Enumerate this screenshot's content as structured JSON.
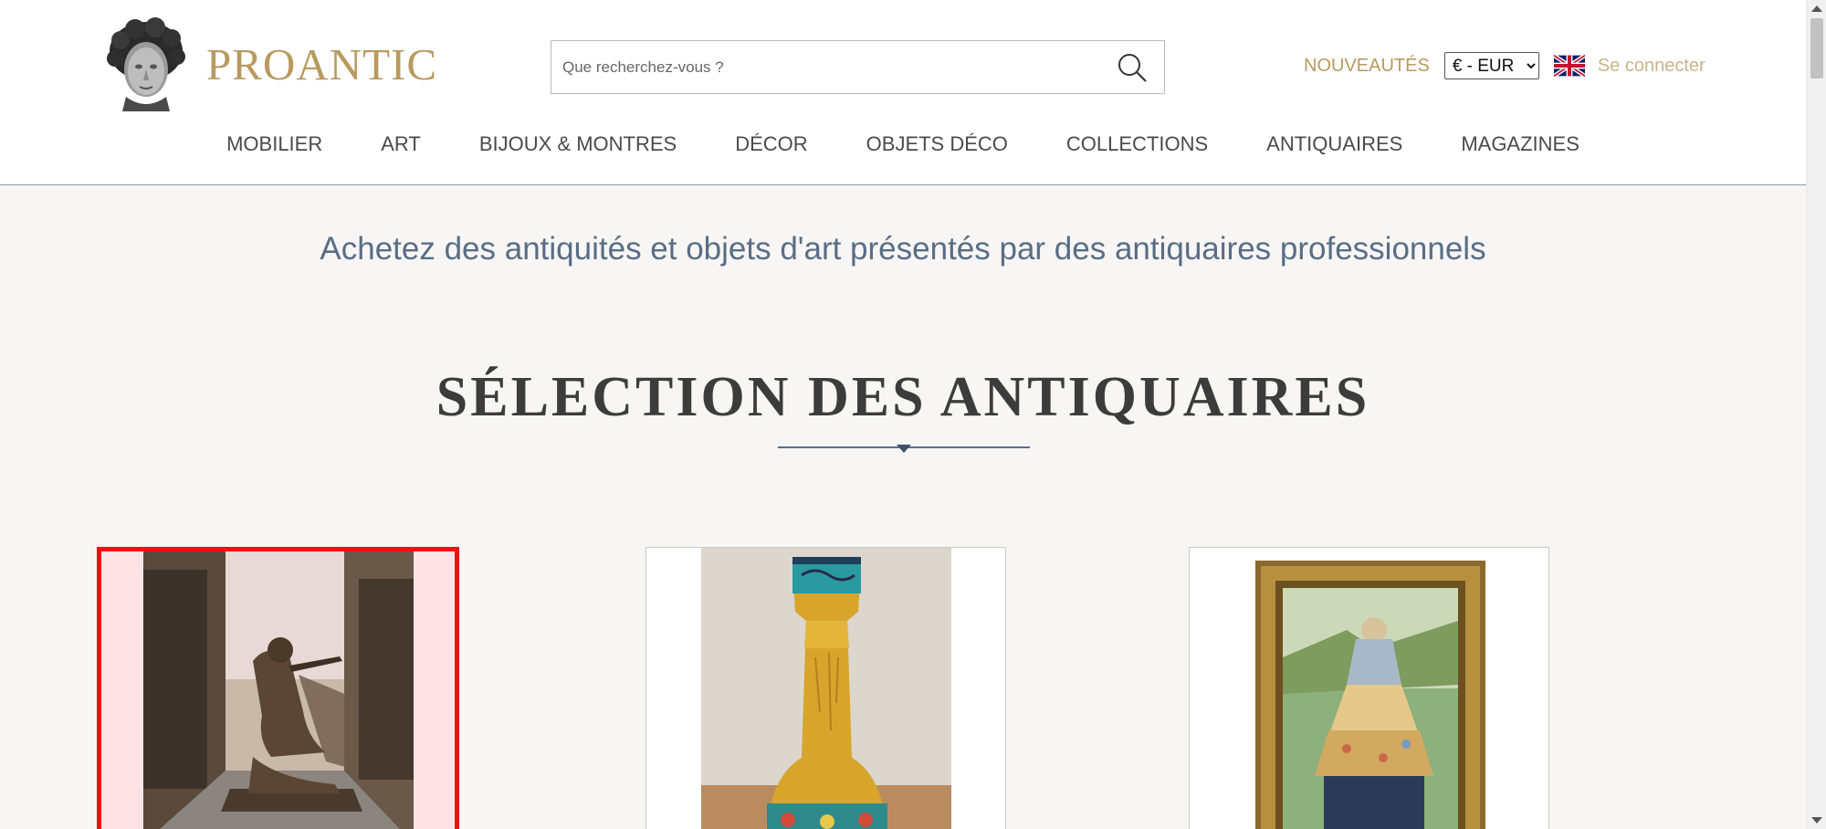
{
  "header": {
    "logo_text": "PROANTIC",
    "search": {
      "placeholder": "Que recherchez-vous ?",
      "icon": "search-icon"
    },
    "new_link": "NOUVEAUTÉS",
    "currency": {
      "selected": "€ - EUR"
    },
    "language_flag": "uk-flag-icon",
    "login_link": "Se connecter"
  },
  "nav": {
    "items": [
      {
        "label": "MOBILIER"
      },
      {
        "label": "ART"
      },
      {
        "label": "BIJOUX & MONTRES"
      },
      {
        "label": "DÉCOR"
      },
      {
        "label": "OBJETS DÉCO"
      },
      {
        "label": "COLLECTIONS"
      },
      {
        "label": "ANTIQUAIRES"
      },
      {
        "label": "MAGAZINES"
      }
    ]
  },
  "main": {
    "tagline": "Achetez des antiquités et objets d'art présentés par des antiquaires professionnels",
    "section_title": "SÉLECTION DES ANTIQUAIRES",
    "products": [
      {
        "image": "bronze-sculpture-flute-player",
        "selected": true
      },
      {
        "image": "cloisonne-enamel-gilt-vase",
        "selected": false
      },
      {
        "image": "framed-painting-woman-in-dress",
        "selected": false
      }
    ]
  },
  "colors": {
    "brand_gold": "#b89a5e",
    "tagline_blue": "#5a6d85",
    "selection_red": "#ee1111",
    "page_background": "#f7f6f4"
  }
}
